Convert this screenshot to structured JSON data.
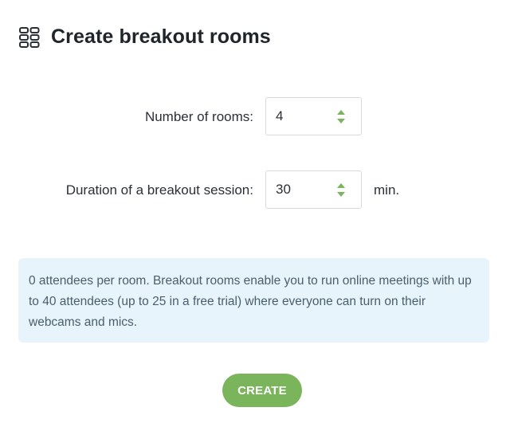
{
  "header": {
    "icon": "breakout-grid-icon",
    "title": "Create breakout rooms"
  },
  "form": {
    "rooms": {
      "label": "Number of rooms:",
      "value": "4"
    },
    "duration": {
      "label": "Duration of a breakout session:",
      "value": "30",
      "unit": "min."
    }
  },
  "info": {
    "text": "0 attendees per room. Breakout rooms enable you to run online meetings with up to 40 attendees (up to 25 in a free trial) where everyone can turn on their webcams and mics."
  },
  "actions": {
    "create_label": "CREATE"
  },
  "colors": {
    "accent": "#7ab55c",
    "info_background": "#e8f4fb",
    "text": "#2b2f36"
  }
}
